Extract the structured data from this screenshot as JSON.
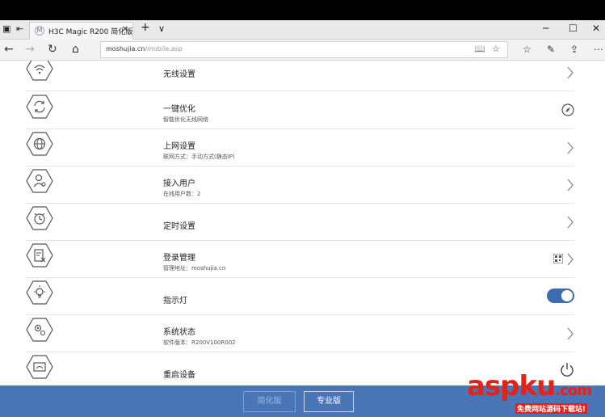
{
  "browser": {
    "tab_title": "H3C Magic R200 简化版",
    "tab_favicon": "M",
    "new_tab_icon": "+",
    "tab_dropdown_icon": "∨",
    "close_tab_icon": "✕",
    "address_host": "moshujia.cn",
    "address_path": "/mobile.asp"
  },
  "settings_list": [
    {
      "label": "无线设置",
      "sub": "",
      "icon": "wifi-icon",
      "right": "chevron"
    },
    {
      "label": "一键优化",
      "sub": "智能优化无线网络",
      "icon": "refresh-icon",
      "right": "compass"
    },
    {
      "label": "上网设置",
      "sub": "联网方式：手动方式(静态IP)",
      "icon": "globe-icon",
      "right": "chevron"
    },
    {
      "label": "接入用户",
      "sub": "在线用户数：2",
      "icon": "users-icon",
      "right": "chevron"
    },
    {
      "label": "定时设置",
      "sub": "",
      "icon": "alarm-clock-icon",
      "right": "chevron"
    },
    {
      "label": "登录管理",
      "sub": "管理地址：moshujia.cn",
      "icon": "login-manage-icon",
      "right": "qr-chevron"
    },
    {
      "label": "指示灯",
      "sub": "",
      "icon": "light-bulb-icon",
      "right": "toggle"
    },
    {
      "label": "系统状态",
      "sub": "软件版本：R200V100R002",
      "icon": "gear-icon",
      "right": "chevron"
    },
    {
      "label": "重启设备",
      "sub": "",
      "icon": "restart-device-icon",
      "right": "power"
    }
  ],
  "indicator_light": {
    "on": true,
    "accent": "#3b6bb0"
  },
  "bottom": {
    "simple_label": "简化版",
    "pro_label": "专业版",
    "bar_color": "#4a76b7"
  },
  "watermark": {
    "big": "aspku",
    "tld": ".com",
    "tagline": "免费网站源码下载站!"
  }
}
